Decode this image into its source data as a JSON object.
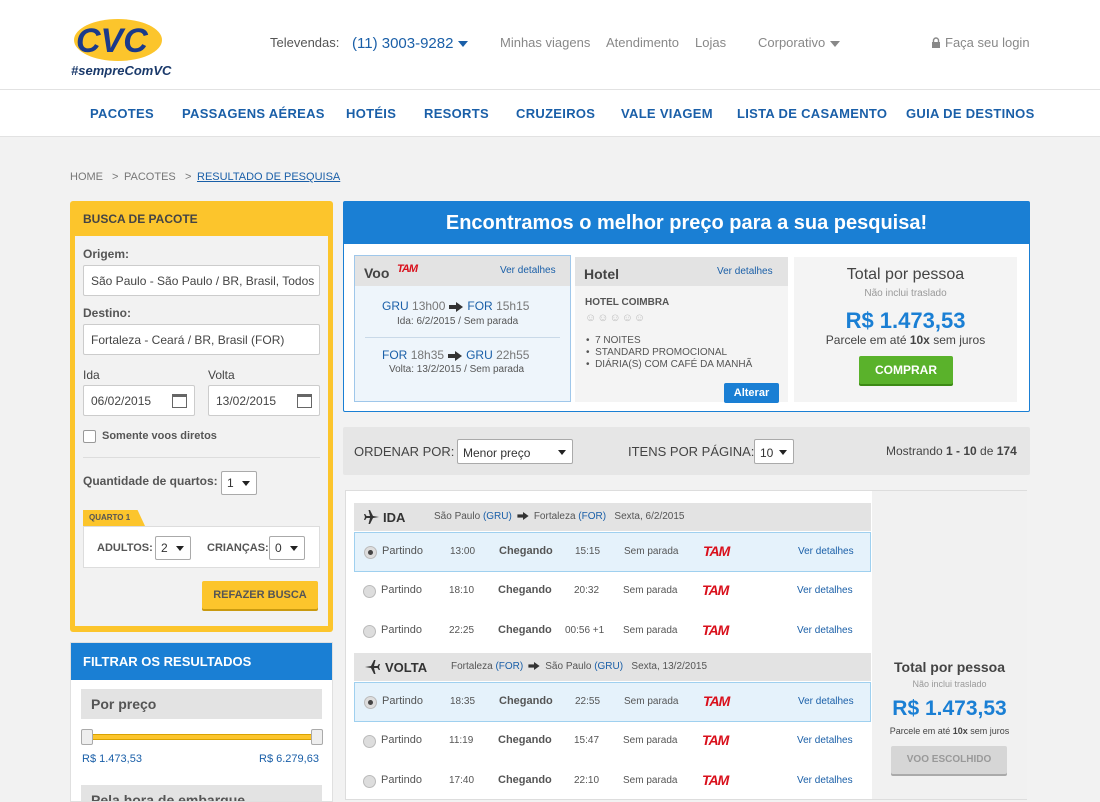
{
  "header": {
    "logo_text": "CVC",
    "tagline": "#sempreComVC",
    "televendas_label": "Televendas:",
    "televendas_number": "(11) 3003-9282",
    "links": [
      "Minhas viagens",
      "Atendimento",
      "Lojas"
    ],
    "corporativo": "Corporativo",
    "login": "Faça seu login"
  },
  "nav": [
    "PACOTES",
    "PASSAGENS AÉREAS",
    "HOTÉIS",
    "RESORTS",
    "CRUZEIROS",
    "VALE VIAGEM",
    "LISTA DE CASAMENTO",
    "GUIA DE DESTINOS"
  ],
  "breadcrumb": {
    "home": "HOME",
    "sep1": ">",
    "pacotes": "PACOTES",
    "sep2": ">",
    "current": "RESULTADO DE PESQUISA"
  },
  "search": {
    "title": "BUSCA DE PACOTE",
    "origem_label": "Origem:",
    "origem_value": "São Paulo - São Paulo / BR, Brasil, Todos",
    "destino_label": "Destino:",
    "destino_value": "Fortaleza - Ceará / BR, Brasil (FOR)",
    "ida_label": "Ida",
    "ida_value": "06/02/2015",
    "volta_label": "Volta",
    "volta_value": "13/02/2015",
    "direct_label": "Somente voos diretos",
    "rooms_label": "Quantidade de quartos:",
    "rooms_value": "1",
    "quarto_tag": "QUARTO 1",
    "adultos_label": "ADULTOS:",
    "adultos_value": "2",
    "criancas_label": "CRIANÇAS:",
    "criancas_value": "0",
    "refazer": "REFAZER BUSCA"
  },
  "filter": {
    "title": "FILTRAR OS RESULTADOS",
    "price_title": "Por preço",
    "min": "R$ 1.473,53",
    "max": "R$ 6.279,63",
    "next_title": "Pela hora de embarque"
  },
  "best": {
    "title": "Encontramos o melhor preço para a sua pesquisa!",
    "voo_label": "Voo",
    "ver_detalhes": "Ver detalhes",
    "ida": {
      "from": "GRU",
      "dep": "13h00",
      "to": "FOR",
      "arr": "15h15",
      "note": "Ida: 6/2/2015 / Sem parada"
    },
    "volta": {
      "from": "FOR",
      "dep": "18h35",
      "to": "GRU",
      "arr": "22h55",
      "note": "Volta: 13/2/2015 / Sem parada"
    },
    "hotel_label": "Hotel",
    "hotel_name": "HOTEL COIMBRA",
    "hotel_items": [
      "7 NOITES",
      "STANDARD PROMOCIONAL",
      "DIÁRIA(S) COM CAFÉ DA MANHÃ"
    ],
    "alterar": "Alterar",
    "total_label": "Total por pessoa",
    "no_transfer": "Não inclui traslado",
    "price": "R$ 1.473,53",
    "installments_pre": "Parcele em até ",
    "installments_bold": "10x",
    "installments_post": " sem juros",
    "comprar": "COMPRAR"
  },
  "sort": {
    "order_label": "ORDENAR POR:",
    "order_value": "Menor preço",
    "items_label": "ITENS POR PÁGINA:",
    "items_value": "10",
    "showing_pre": "Mostrando ",
    "showing_range": "1 - 10",
    "showing_mid": " de ",
    "showing_total": "174"
  },
  "results": {
    "ida_header": {
      "label": "IDA",
      "from": "São Paulo",
      "from_code": "(GRU)",
      "to": "Fortaleza",
      "to_code": "(FOR)",
      "date": "Sexta, 6/2/2015"
    },
    "volta_header": {
      "label": "VOLTA",
      "from": "Fortaleza",
      "from_code": "(FOR)",
      "to": "São Paulo",
      "to_code": "(GRU)",
      "date": "Sexta, 13/2/2015"
    },
    "partindo": "Partindo",
    "chegando": "Chegando",
    "ver_detalhes": "Ver detalhes",
    "airline": "TAM",
    "ida_rows": [
      {
        "dep": "13:00",
        "arr": "15:15",
        "stops": "Sem parada",
        "selected": true
      },
      {
        "dep": "18:10",
        "arr": "20:32",
        "stops": "Sem parada",
        "selected": false
      },
      {
        "dep": "22:25",
        "arr": "00:56 +1",
        "stops": "Sem parada",
        "selected": false
      }
    ],
    "volta_rows": [
      {
        "dep": "18:35",
        "arr": "22:55",
        "stops": "Sem parada",
        "selected": true
      },
      {
        "dep": "11:19",
        "arr": "15:47",
        "stops": "Sem parada",
        "selected": false
      },
      {
        "dep": "17:40",
        "arr": "22:10",
        "stops": "Sem parada",
        "selected": false
      }
    ],
    "total_label": "Total por pessoa",
    "no_transfer": "Não inclui traslado",
    "price": "R$ 1.473,53",
    "installments_pre": "Parcele em até ",
    "installments_bold": "10x",
    "installments_post": " sem juros",
    "chosen": "VOO ESCOLHIDO"
  },
  "colors": {
    "brand_blue": "#1a7fd4",
    "link_blue": "#1a5fa8",
    "yellow": "#fcc52c",
    "green": "#5ab22b",
    "tam_red": "#d9101c"
  }
}
